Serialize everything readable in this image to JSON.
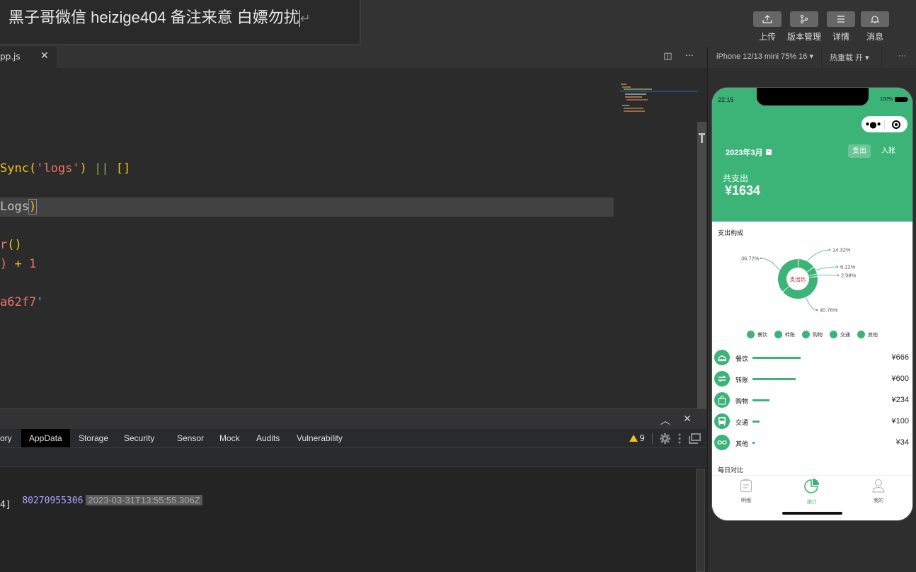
{
  "overlay_text": "黑子哥微信 heizige404  备注来意 白嫖勿扰",
  "toolbar": {
    "buttons": [
      {
        "label": "上传",
        "icon": "upload-icon"
      },
      {
        "label": "版本管理",
        "icon": "branch-icon"
      },
      {
        "label": "详情",
        "icon": "menu-icon"
      },
      {
        "label": "消息",
        "icon": "bell-icon"
      }
    ]
  },
  "editor": {
    "tab_label": "pp.js",
    "close_glyph": "✕",
    "split_glyph": "◫",
    "more_glyph": "···",
    "lines": [
      {
        "parts": [
          [
            "c-y",
            "Sync("
          ],
          [
            "c-r",
            "'logs'"
          ],
          [
            "c-y",
            ") "
          ],
          [
            "c-gr",
            "||"
          ],
          [
            "c-y",
            " []"
          ]
        ]
      },
      {
        "parts": [
          [
            "c-g",
            "Logs"
          ],
          [
            "c-y",
            ")"
          ]
        ]
      },
      {
        "parts": [
          [
            "c-r",
            "r"
          ],
          [
            "c-y",
            "()"
          ]
        ]
      },
      {
        "parts": [
          [
            "c-r",
            ")"
          ],
          [
            "c-y",
            " + "
          ],
          [
            "c-r",
            "1"
          ]
        ]
      },
      {
        "parts": [
          [
            "c-r",
            "a62f7"
          ],
          [
            "c-b",
            "'"
          ]
        ]
      }
    ]
  },
  "panel": {
    "collapse_glyph": "︿",
    "close_glyph": "✕",
    "tabs": [
      "ory",
      "AppData",
      "Storage",
      "Security",
      "Sensor",
      "Mock",
      "Audits",
      "Vulnerability"
    ],
    "active_tab": "AppData",
    "warning_count": "9",
    "console": {
      "line1_value": "80270955306",
      "line1_timestamp": "2023-03-31T13:55:55.306Z",
      "line2_value": "4]"
    }
  },
  "simulator": {
    "device": "iPhone 12/13 mini 75% 16 ▾",
    "hot_reload": "热重载 开 ▾",
    "more": "···"
  },
  "phone": {
    "status_time": "22:15",
    "battery": "100%",
    "capsule_dots": "•●•",
    "month": "2023年3月",
    "type_tabs": [
      "支出",
      "入账"
    ],
    "active_type": "支出",
    "total_label": "共支出",
    "total_value": "¥1634",
    "composition_title": "支出构成",
    "daily_title": "每日对比",
    "categories": [
      {
        "name": "餐饮",
        "amount": "¥666",
        "value": 666,
        "icon": "dining-icon"
      },
      {
        "name": "转账",
        "amount": "¥600",
        "value": 600,
        "icon": "transfer-icon"
      },
      {
        "name": "购物",
        "amount": "¥234",
        "value": 234,
        "icon": "shopping-icon"
      },
      {
        "name": "交通",
        "amount": "¥100",
        "value": 100,
        "icon": "bus-icon"
      },
      {
        "name": "其他",
        "amount": "¥34",
        "value": 34,
        "icon": "infinity-icon"
      }
    ],
    "tabbar": [
      {
        "label": "明细",
        "icon": "list-icon",
        "active": false
      },
      {
        "label": "统计",
        "icon": "pie-chart-icon",
        "active": true
      },
      {
        "label": "我的",
        "icon": "user-icon",
        "active": false
      }
    ]
  },
  "chart_data": {
    "type": "pie",
    "title": "支出构成",
    "center_label": "支出比",
    "categories": [
      "餐饮",
      "转账",
      "购物",
      "交通",
      "其他"
    ],
    "values": [
      40.76,
      36.72,
      14.32,
      6.12,
      2.08
    ],
    "labels": [
      "40.76%",
      "36.72%",
      "14.32%",
      "6.12%",
      "2.08%"
    ],
    "legend_position": "bottom",
    "colors": {
      "slice": "#3db477",
      "center_text": "#e02020"
    }
  }
}
